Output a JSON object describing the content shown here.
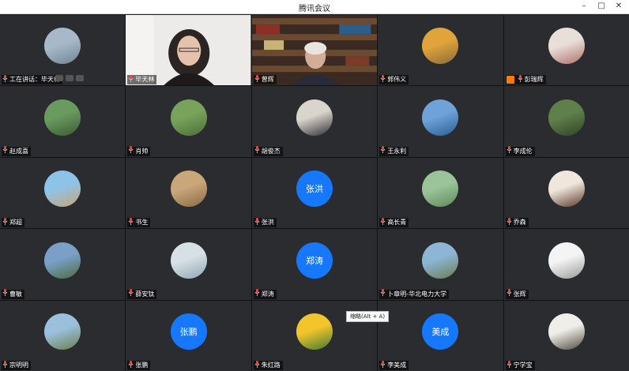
{
  "window": {
    "title": "腾讯会议"
  },
  "tooltip": "缩略(Alt + A)",
  "participants": [
    {
      "name": "工在讲话：毕天林",
      "type": "photo",
      "colors": [
        "#a7b9c8",
        "#6f8596"
      ]
    },
    {
      "name": "毕天林",
      "type": "video-woman"
    },
    {
      "name": "曾辉",
      "type": "video-man"
    },
    {
      "name": "郭伟义",
      "type": "photo",
      "colors": [
        "#e0a43a",
        "#8a6b3c"
      ]
    },
    {
      "name": "彭瑞辉",
      "type": "photo",
      "colors": [
        "#e8e0d8",
        "#b06f6a"
      ],
      "host": true
    },
    {
      "name": "赵成喜",
      "type": "photo",
      "colors": [
        "#6a9a5e",
        "#3a5a35"
      ]
    },
    {
      "name": "肖帅",
      "type": "photo",
      "colors": [
        "#79a35b",
        "#4b6d39"
      ]
    },
    {
      "name": "胡俊杰",
      "type": "photo",
      "colors": [
        "#d9d4cc",
        "#2e2e36"
      ]
    },
    {
      "name": "王永利",
      "type": "photo",
      "colors": [
        "#6ea2d8",
        "#2a5f95"
      ]
    },
    {
      "name": "李成伦",
      "type": "photo",
      "colors": [
        "#5f7f4b",
        "#2f4326"
      ]
    },
    {
      "name": "郑超",
      "type": "photo",
      "colors": [
        "#8ec3e8",
        "#c9a678"
      ]
    },
    {
      "name": "书生",
      "type": "photo",
      "colors": [
        "#c9a77a",
        "#8a6a44"
      ]
    },
    {
      "name": "张洪",
      "type": "text",
      "label": "张洪"
    },
    {
      "name": "高长青",
      "type": "photo",
      "colors": [
        "#9cc49a",
        "#5d8b5a"
      ]
    },
    {
      "name": "乔森",
      "type": "photo",
      "colors": [
        "#efe6dc",
        "#5c3b2a"
      ]
    },
    {
      "name": "曹敏",
      "type": "photo",
      "colors": [
        "#7aa0c8",
        "#4d6b3f"
      ]
    },
    {
      "name": "薛安钛",
      "type": "photo",
      "colors": [
        "#d7e0e4",
        "#8fa9b8"
      ]
    },
    {
      "name": "郑涛",
      "type": "text",
      "label": "郑涛"
    },
    {
      "name": "卜章明-华北电力大学",
      "type": "photo",
      "colors": [
        "#8cb5d6",
        "#6c7d4b"
      ]
    },
    {
      "name": "张辉",
      "type": "photo",
      "colors": [
        "#f4f4f4",
        "#9a9a9a"
      ]
    },
    {
      "name": "宗明明",
      "type": "photo",
      "colors": [
        "#9ac0dc",
        "#6b7f4e"
      ]
    },
    {
      "name": "张鹏",
      "type": "text",
      "label": "张鹏"
    },
    {
      "name": "朱红路",
      "type": "photo",
      "colors": [
        "#f3c52a",
        "#3f7a36"
      ]
    },
    {
      "name": "李美成",
      "type": "text",
      "label": "美成"
    },
    {
      "name": "宁学宝",
      "type": "photo",
      "colors": [
        "#f0eee8",
        "#4c4a3f"
      ]
    }
  ]
}
